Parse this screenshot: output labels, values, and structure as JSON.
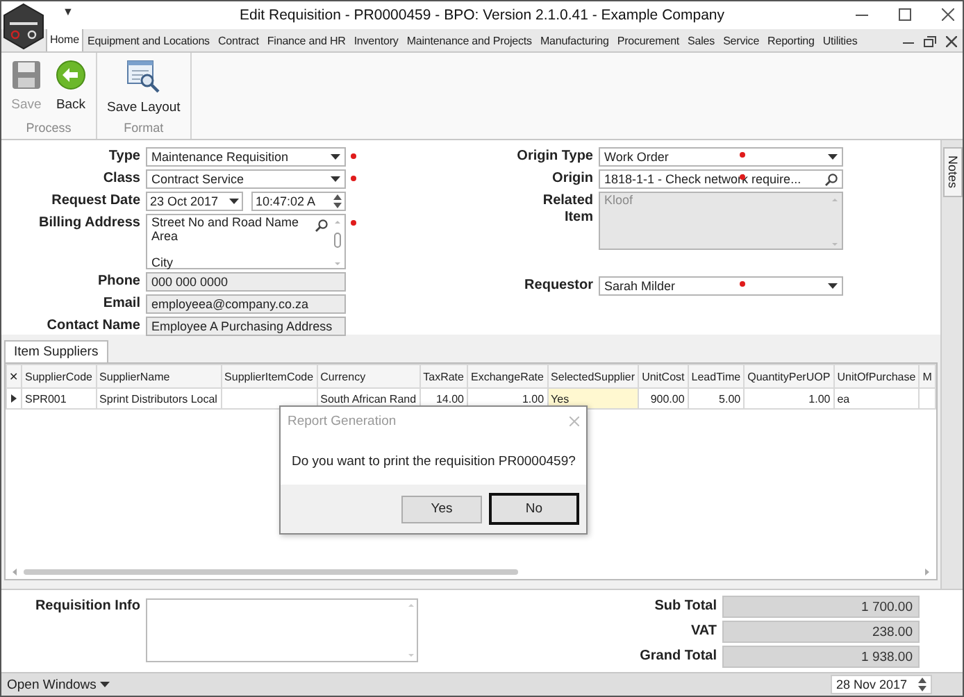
{
  "window": {
    "title": "Edit Requisition - PR0000459 - BPO: Version 2.1.0.41 - Example Company",
    "quick_access": "▼"
  },
  "tabs": [
    {
      "label": "Home",
      "selected": true
    },
    {
      "label": "Equipment and Locations",
      "selected": false
    },
    {
      "label": "Contract",
      "selected": false
    },
    {
      "label": "Finance and HR",
      "selected": false
    },
    {
      "label": "Inventory",
      "selected": false
    },
    {
      "label": "Maintenance and Projects",
      "selected": false
    },
    {
      "label": "Manufacturing",
      "selected": false
    },
    {
      "label": "Procurement",
      "selected": false
    },
    {
      "label": "Sales",
      "selected": false
    },
    {
      "label": "Service",
      "selected": false
    },
    {
      "label": "Reporting",
      "selected": false
    },
    {
      "label": "Utilities",
      "selected": false
    }
  ],
  "ribbon": {
    "groups": [
      {
        "label": "Process",
        "buttons": [
          {
            "label": "Save",
            "kind": "save",
            "disabled": true
          },
          {
            "label": "Back",
            "kind": "back",
            "disabled": false
          }
        ]
      },
      {
        "label": "Format",
        "buttons": [
          {
            "label": "Save Layout",
            "kind": "layout",
            "disabled": false
          }
        ]
      }
    ]
  },
  "form": {
    "left": [
      {
        "label": "Type",
        "kind": "dropdown",
        "value": "Maintenance Requisition",
        "required": true
      },
      {
        "label": "Class",
        "kind": "dropdown",
        "value": "Contract Service",
        "required": true
      },
      {
        "label": "Request Date",
        "kind": "datetime",
        "value": "23 Oct 2017",
        "time": "10:47:02 A"
      },
      {
        "label": "Billing Address",
        "kind": "memo",
        "text": "Street No and Road Name\nArea\n\nCity",
        "required": true
      },
      {
        "label": "Phone",
        "kind": "text",
        "value": "000 000 0000",
        "readonly": true
      },
      {
        "label": "Email",
        "kind": "text",
        "value": "employeea@company.co.za",
        "readonly": true
      },
      {
        "label": "Contact Name",
        "kind": "text",
        "value": "Employee A Purchasing Address",
        "readonly": true
      }
    ],
    "right": [
      {
        "label": "Origin Type",
        "kind": "dropdown",
        "value": "Work Order",
        "required": true
      },
      {
        "label": "Origin",
        "kind": "search",
        "value": "1818-1-1 - Check network require...",
        "required": true
      },
      {
        "label": "Related Item",
        "kind": "memo",
        "text": "Kloof",
        "disabled": true
      },
      {
        "label": "Requestor",
        "kind": "dropdown",
        "value": "Sarah Milder",
        "required": true
      }
    ]
  },
  "notes_tab": {
    "label": "Notes"
  },
  "grid": {
    "tab": "Item Suppliers",
    "close_glyph": "✕",
    "columns": [
      {
        "label": "SupplierCode",
        "kind": "text"
      },
      {
        "label": "SupplierName",
        "kind": "text"
      },
      {
        "label": "SupplierItemCode",
        "kind": "text"
      },
      {
        "label": "Currency",
        "kind": "text"
      },
      {
        "label": "TaxRate",
        "kind": "number"
      },
      {
        "label": "ExchangeRate",
        "kind": "number"
      },
      {
        "label": "SelectedSupplier",
        "kind": "text"
      },
      {
        "label": "UnitCost",
        "kind": "number"
      },
      {
        "label": "LeadTime",
        "kind": "number"
      },
      {
        "label": "QuantityPerUOP",
        "kind": "number"
      },
      {
        "label": "UnitOfPurchase",
        "kind": "text"
      },
      {
        "label": "M",
        "kind": "text"
      }
    ],
    "rows": [
      {
        "current": true,
        "cells": [
          {
            "text": "SPR001",
            "selected": false
          },
          {
            "text": "Sprint Distributors Local",
            "selected": false
          },
          {
            "selected": false
          },
          {
            "text": "South African Rand",
            "selected": false
          },
          {
            "text": "14.00",
            "selected": false
          },
          {
            "text": "1.00",
            "selected": false
          },
          {
            "text": "Yes",
            "selected": true
          },
          {
            "text": "900.00",
            "selected": false
          },
          {
            "text": "5.00",
            "selected": false
          },
          {
            "text": "1.00",
            "selected": false
          },
          {
            "text": "ea",
            "selected": false
          }
        ]
      }
    ]
  },
  "dialog": {
    "title": "Report Generation",
    "message": "Do you want to print the requisition PR0000459?",
    "buttons": [
      {
        "label": "Yes",
        "focused": false
      },
      {
        "label": "No",
        "focused": true
      }
    ]
  },
  "footer": {
    "info_label": "Requisition Info",
    "totals": [
      {
        "label": "Sub Total",
        "value": "1 700.00"
      },
      {
        "label": "VAT",
        "value": "238.00"
      },
      {
        "label": "Grand Total",
        "value": "1 938.00"
      }
    ]
  },
  "status_bar": {
    "open_windows": "Open Windows",
    "date": "28 Nov 2017"
  }
}
